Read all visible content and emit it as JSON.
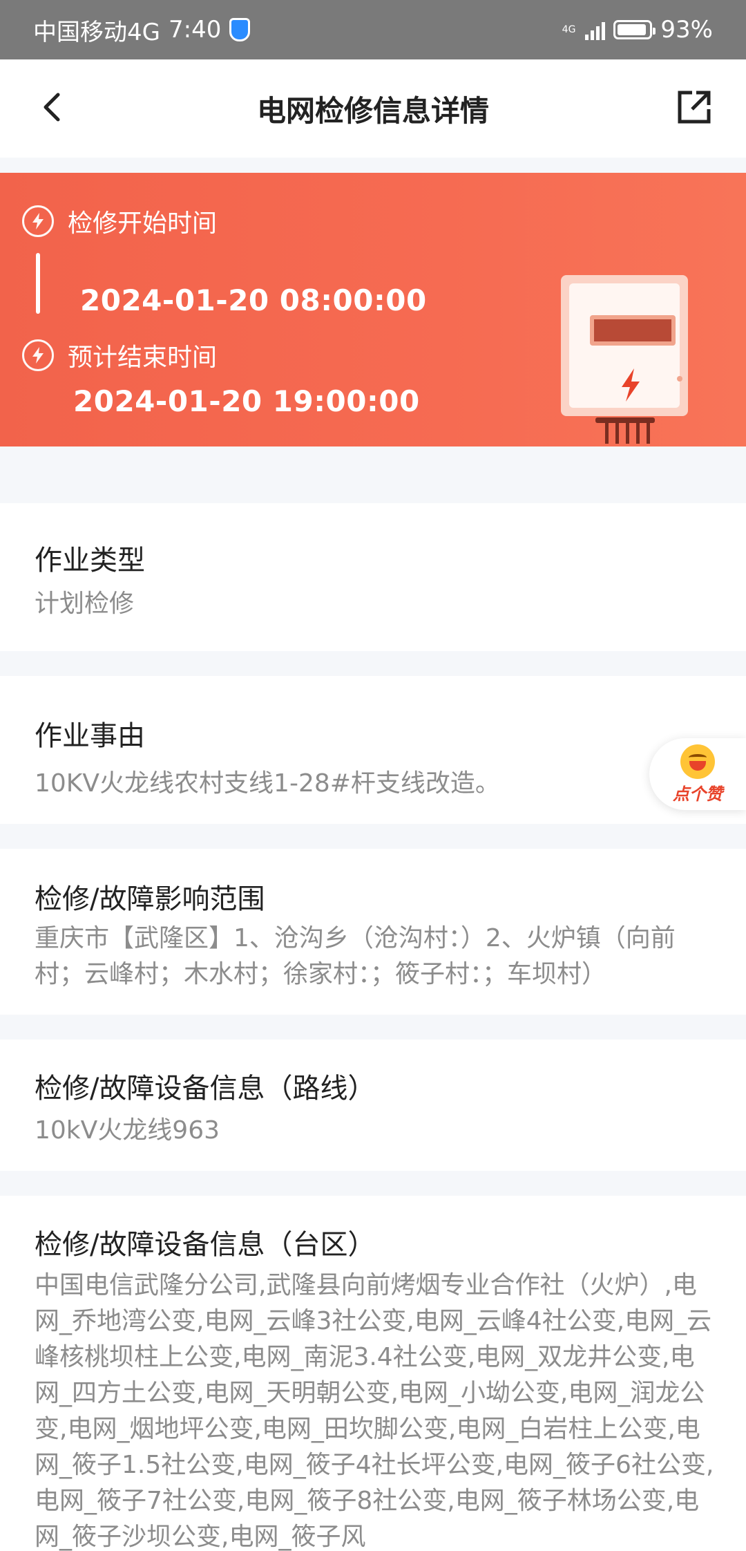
{
  "status_bar": {
    "carrier": "中国移动4G",
    "time": "7:40",
    "network": "4G",
    "battery": "93%",
    "battery_level": 0.93
  },
  "header": {
    "title": "电网检修信息详情"
  },
  "banner": {
    "start_label": "检修开始时间",
    "start_time": "2024-01-20 08:00:00",
    "end_label": "预计结束时间",
    "end_time": "2024-01-20 19:00:00"
  },
  "sections": {
    "work_type": {
      "title": "作业类型",
      "value": "计划检修"
    },
    "work_reason": {
      "title": "作业事由",
      "value": "10KV火龙线农村支线1-28#杆支线改造。"
    },
    "impact_scope": {
      "title": "检修/故障影响范围",
      "value": "重庆市【武隆区】1、沧沟乡（沧沟村：）2、火炉镇（向前村；云峰村；木水村；徐家村：；筱子村：；车坝村）"
    },
    "device_line": {
      "title": "检修/故障设备信息（路线）",
      "value": "10kV火龙线963"
    },
    "device_area": {
      "title": "检修/故障设备信息（台区）",
      "value": "中国电信武隆分公司,武隆县向前烤烟专业合作社（火炉）,电网_乔地湾公变,电网_云峰3社公变,电网_云峰4社公变,电网_云峰核桃坝柱上公变,电网_南泥3.4社公变,电网_双龙井公变,电网_四方土公变,电网_天明朝公变,电网_小坳公变,电网_润龙公变,电网_烟地坪公变,电网_田坎脚公变,电网_白岩柱上公变,电网_筱子1.5社公变,电网_筱子4社长坪公变,电网_筱子6社公变,电网_筱子7社公变,电网_筱子8社公变,电网_筱子林场公变,电网_筱子沙坝公变,电网_筱子风"
    }
  },
  "like_button": {
    "label": "点个赞"
  },
  "icons": [
    "back-chevron-icon",
    "share-icon",
    "bolt-circle-icon",
    "electric-meter-icon",
    "smile-emoji-icon"
  ],
  "colors": {
    "banner": "#f2634b",
    "value_text": "#8c8c8c",
    "like_red": "#e8432a"
  }
}
